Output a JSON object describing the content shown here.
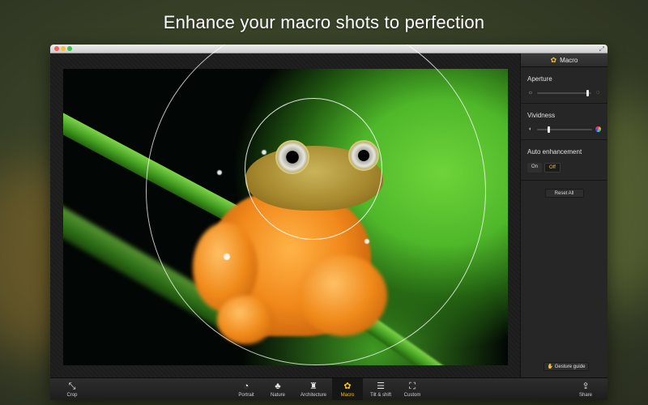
{
  "headline": "Enhance your macro shots to perfection",
  "window": {
    "title": ""
  },
  "panel": {
    "mode_icon": "flower-icon",
    "mode_title": "Macro",
    "aperture": {
      "label": "Aperture",
      "value": 0.93,
      "min_icon": "aperture-closed-icon",
      "max_icon": "aperture-open-icon"
    },
    "vividness": {
      "label": "Vividness",
      "value": 0.2,
      "min_icon": "half-circle-icon",
      "max_icon": "color-wheel-icon"
    },
    "auto_enhancement": {
      "label": "Auto enhancement",
      "on_label": "On",
      "off_label": "Off",
      "selected": "Off"
    },
    "reset_label": "Reset All",
    "gesture_label": "Gesture guide"
  },
  "toolbar": {
    "crop": "Crop",
    "portrait": "Portrait",
    "nature": "Nature",
    "architecture": "Architecture",
    "macro": "Macro",
    "tilt_shift": "Tilt & shift",
    "custom": "Custom",
    "share": "Share"
  },
  "colors": {
    "accent": "#f7c31c",
    "panel_bg": "#262627"
  }
}
